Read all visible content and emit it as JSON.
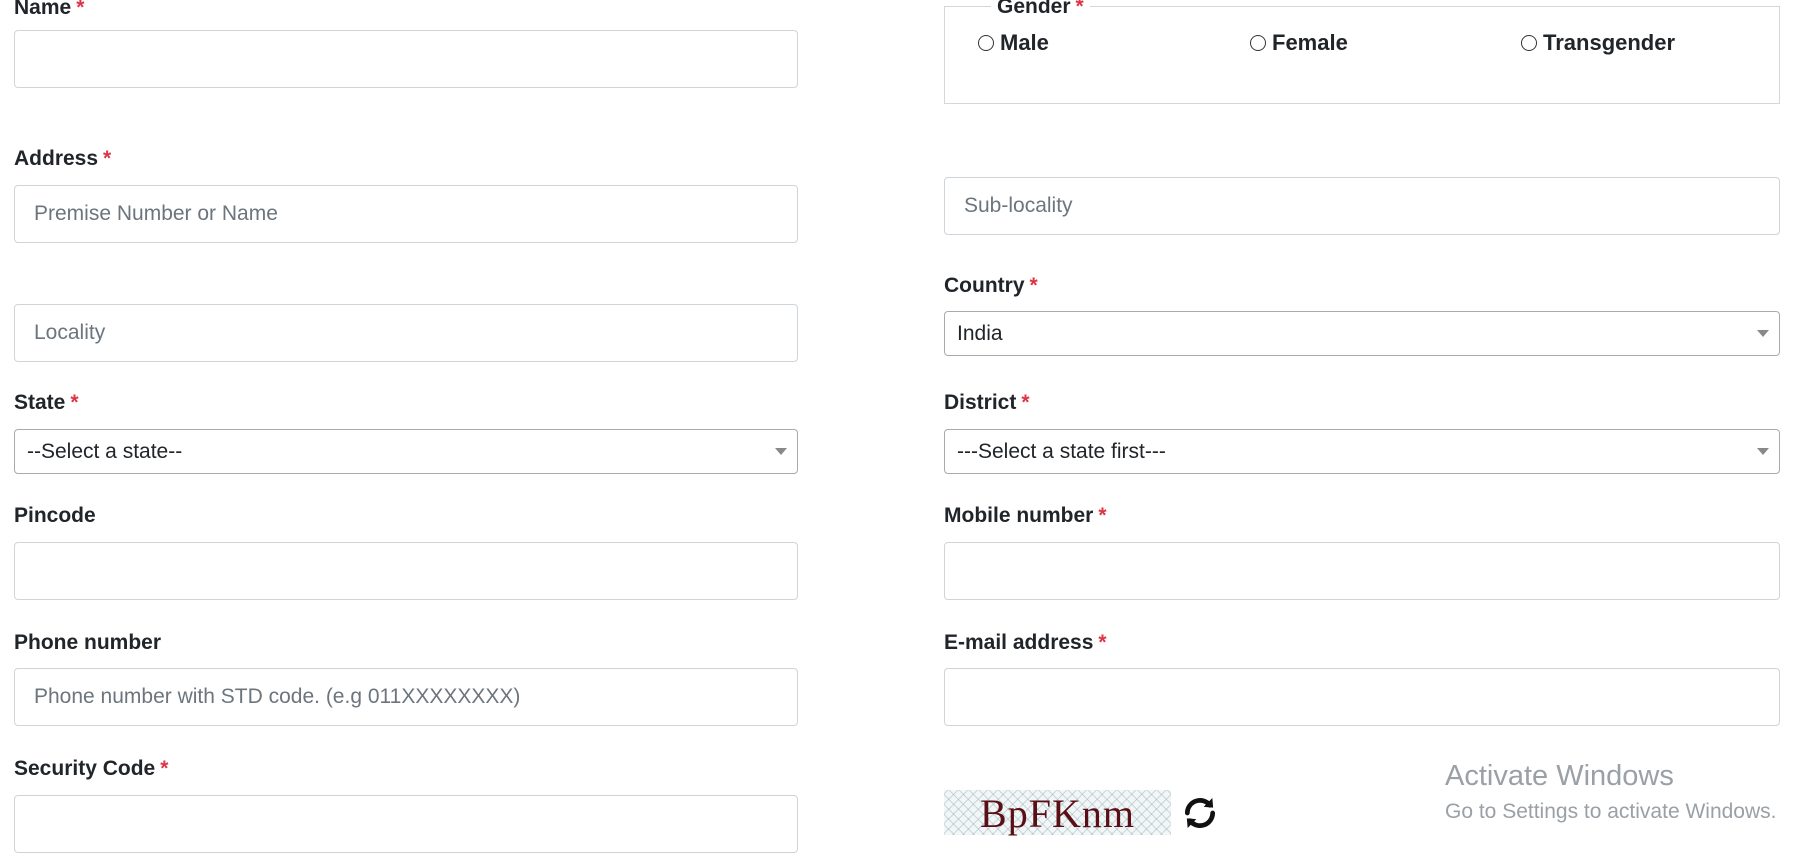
{
  "name": {
    "label": "Name",
    "value": "",
    "placeholder": ""
  },
  "gender": {
    "legend": "Gender",
    "options": [
      "Male",
      "Female",
      "Transgender"
    ],
    "selected": ""
  },
  "address": {
    "label": "Address",
    "premise_placeholder": "Premise Number or Name",
    "sublocality_placeholder": "Sub-locality",
    "locality_placeholder": "Locality"
  },
  "country": {
    "label": "Country",
    "selected": "India"
  },
  "state": {
    "label": "State",
    "selected": "--Select a state--"
  },
  "district": {
    "label": "District",
    "selected": "---Select a state first---"
  },
  "pincode": {
    "label": "Pincode",
    "value": ""
  },
  "mobile": {
    "label": "Mobile number",
    "value": ""
  },
  "phone": {
    "label": "Phone number",
    "placeholder": "Phone number with STD code. (e.g 011XXXXXXXX)"
  },
  "email": {
    "label": "E-mail address",
    "value": ""
  },
  "security": {
    "label": "Security Code",
    "captcha_text": "BpFKnm",
    "value": ""
  },
  "required_marker": "*",
  "watermark": {
    "title": "Activate Windows",
    "subtitle": "Go to Settings to activate Windows."
  },
  "colors": {
    "required": "#dc3545",
    "captcha_text": "#5a0f16"
  },
  "icons": {
    "refresh": "refresh-icon",
    "dropdown": "chevron-down-icon"
  }
}
